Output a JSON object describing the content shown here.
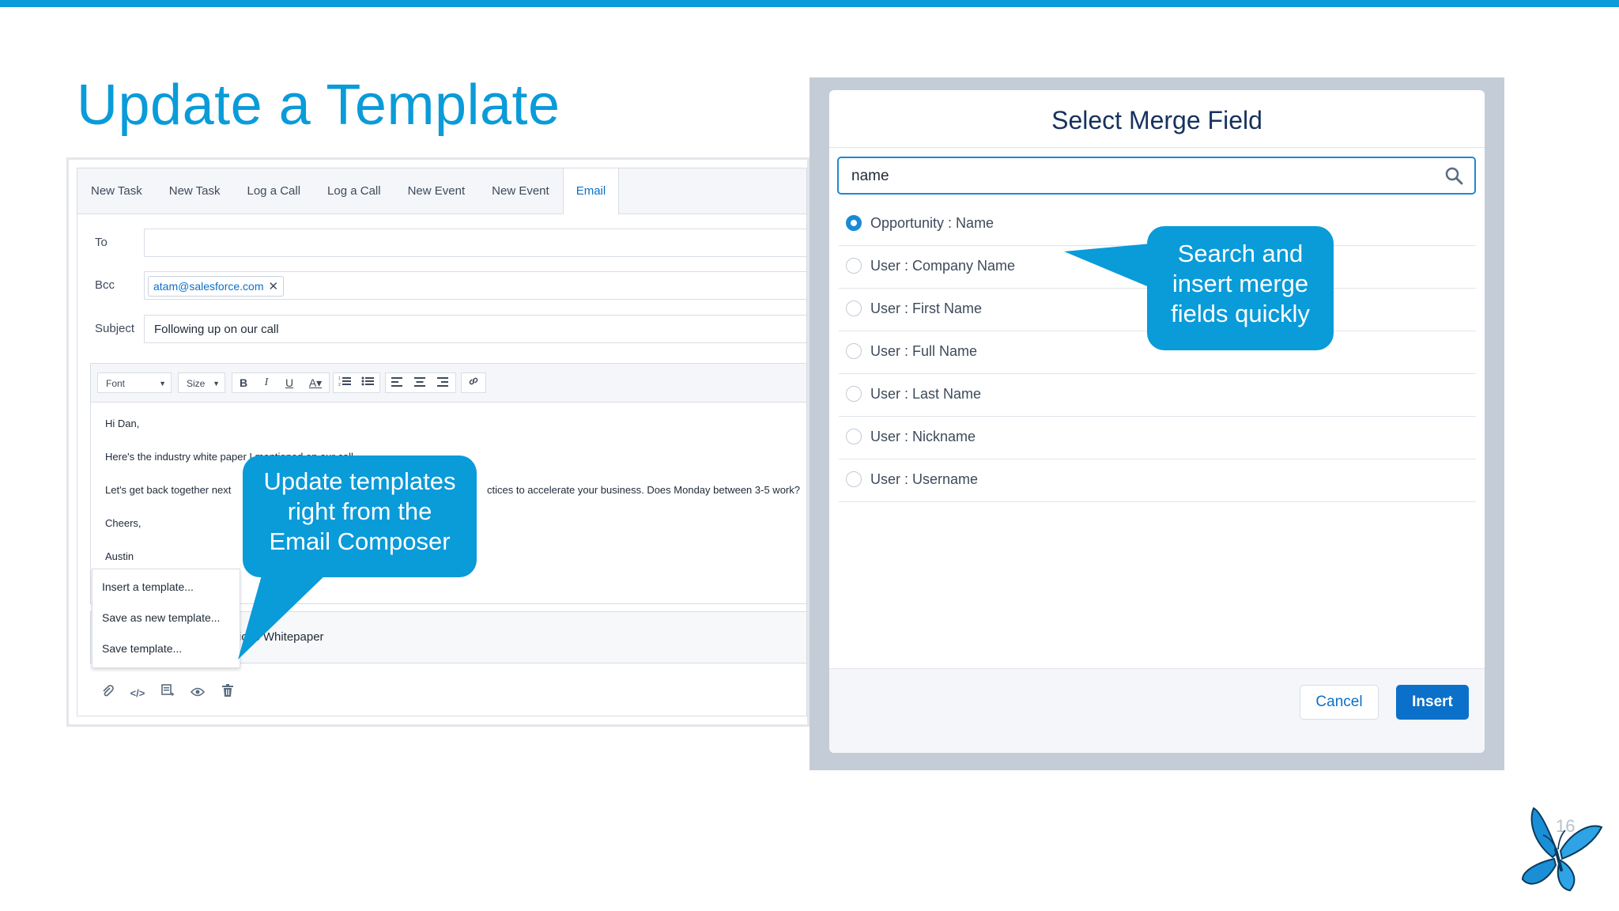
{
  "slide": {
    "title": "Update a Template",
    "page_number": "16"
  },
  "composer": {
    "tabs": [
      "New Task",
      "New Task",
      "Log a Call",
      "Log a Call",
      "New Event",
      "New Event",
      "Email"
    ],
    "active_tab": "Email",
    "to_label": "To",
    "bcc_label": "Bcc",
    "bcc_recipient": "atam@salesforce.com",
    "subject_label": "Subject",
    "subject_value": "Following up on our call",
    "toolbar": {
      "font_label": "Font",
      "size_label": "Size"
    },
    "body": {
      "greeting": "Hi Dan,",
      "line1": "Here's the industry white paper I mentioned on our call.",
      "line2_start": "Let's get back together next",
      "line2_end": "ctices to accelerate your business. Does Monday between 3-5 work?",
      "signoff": "Cheers,",
      "signature": "Austin"
    },
    "attachment_text": "ices Whitepaper",
    "template_menu": [
      "Insert a template...",
      "Save as new template...",
      "Save template..."
    ]
  },
  "callouts": {
    "composer": [
      "Update templates",
      "right from the",
      "Email Composer"
    ],
    "merge": [
      "Search and",
      "insert merge",
      "fields quickly"
    ]
  },
  "modal": {
    "title": "Select Merge Field",
    "search_value": "name",
    "options": [
      {
        "label": "Opportunity : Name",
        "checked": true
      },
      {
        "label": "User : Company Name",
        "checked": false
      },
      {
        "label": "User : First Name",
        "checked": false
      },
      {
        "label": "User : Full Name",
        "checked": false
      },
      {
        "label": "User : Last Name",
        "checked": false
      },
      {
        "label": "User : Nickname",
        "checked": false
      },
      {
        "label": "User : Username",
        "checked": false
      }
    ],
    "cancel_label": "Cancel",
    "insert_label": "Insert"
  },
  "colors": {
    "accent": "#0a9bd9",
    "brand_button": "#0a70c9",
    "title_text": "#16325c"
  }
}
